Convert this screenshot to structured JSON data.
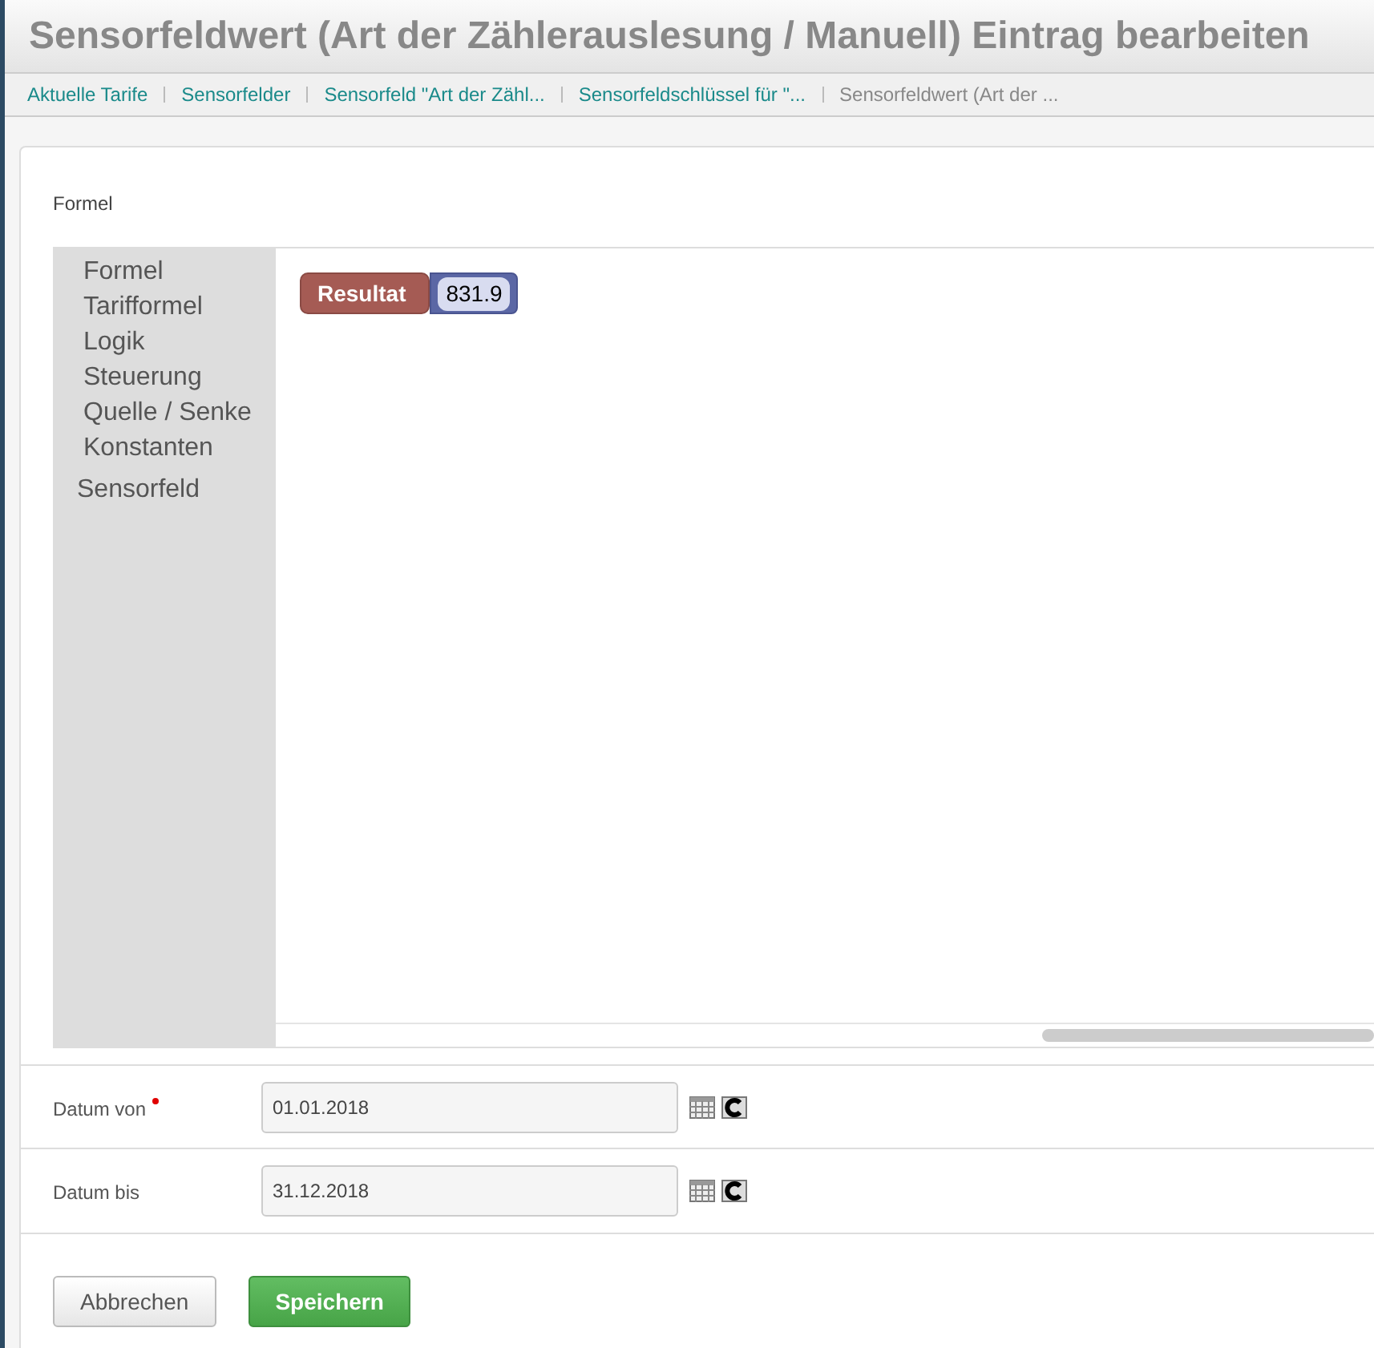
{
  "title": "Sensorfeldwert (Art der Zählerauslesung / Manuell) Eintrag bearbeiten",
  "breadcrumbs": [
    {
      "label": "Aktuelle Tarife",
      "current": false
    },
    {
      "label": "Sensorfelder",
      "current": false
    },
    {
      "label": "Sensorfeld \"Art der Zähl...",
      "current": false
    },
    {
      "label": "Sensorfeldschlüssel für \"...",
      "current": false
    },
    {
      "label": "Sensorfeldwert (Art der ...",
      "current": true
    }
  ],
  "formula": {
    "label": "Formel",
    "toolbox": [
      {
        "label": "Formel",
        "kind": "category"
      },
      {
        "label": "Tarifformel",
        "kind": "category"
      },
      {
        "label": "Logik",
        "kind": "category"
      },
      {
        "label": "Steuerung",
        "kind": "category"
      },
      {
        "label": "Quelle / Senke",
        "kind": "category"
      },
      {
        "label": "Konstanten",
        "kind": "category"
      },
      {
        "label": "Sensorfeld",
        "kind": "plain"
      }
    ],
    "block": {
      "label": "Resultat",
      "value": "831.9"
    }
  },
  "fields": [
    {
      "label": "Datum von",
      "required": true,
      "value": "01.01.2018"
    },
    {
      "label": "Datum bis",
      "required": false,
      "value": "31.12.2018"
    }
  ],
  "buttons": [
    {
      "label": "Abbrechen",
      "kind": "secondary"
    },
    {
      "label": "Speichern",
      "kind": "primary"
    }
  ]
}
